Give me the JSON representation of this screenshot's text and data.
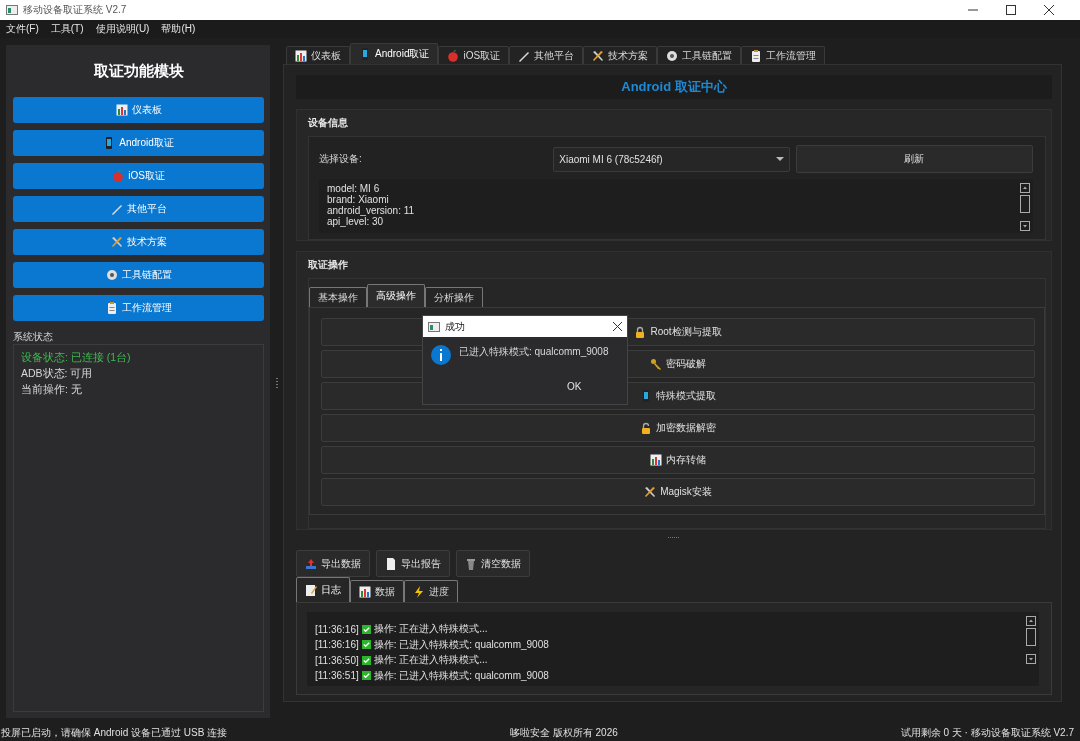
{
  "window": {
    "title": "移动设备取证系统 V2.7"
  },
  "menu": [
    "文件(F)",
    "工具(T)",
    "使用说明(U)",
    "帮助(H)"
  ],
  "sidebar": {
    "title": "取证功能模块",
    "buttons": [
      "仪表板",
      "Android取证",
      "iOS取证",
      "其他平台",
      "技术方案",
      "工具链配置",
      "工作流管理"
    ],
    "status_title": "系统状态",
    "status": [
      {
        "text": "设备状态: 已连接 (1台)",
        "color": "#3fb950"
      },
      {
        "text": "ADB状态: 可用"
      },
      {
        "text": "当前操作: 无"
      }
    ]
  },
  "tabs": [
    {
      "label": "仪表板",
      "selected": false
    },
    {
      "label": "Android取证",
      "selected": true
    },
    {
      "label": "iOS取证",
      "selected": false
    },
    {
      "label": "其他平台",
      "selected": false
    },
    {
      "label": "技术方案",
      "selected": false
    },
    {
      "label": "工具链配置",
      "selected": false
    },
    {
      "label": "工作流管理",
      "selected": false
    }
  ],
  "header": "Android 取证中心",
  "device_info": {
    "title": "设备信息",
    "select_label": "选择设备:",
    "device": "Xiaomi MI 6 (78c5246f)",
    "refresh": "刷新",
    "lines": [
      "model: MI 6",
      "brand: Xiaomi",
      "android_version: 11",
      "api_level: 30"
    ]
  },
  "operations": {
    "title": "取证操作",
    "tabs": [
      {
        "label": "基本操作",
        "selected": false
      },
      {
        "label": "高级操作",
        "selected": true
      },
      {
        "label": "分析操作",
        "selected": false
      }
    ],
    "buttons": [
      "Root检测与提取",
      "密码破解",
      "特殊模式提取",
      "加密数据解密",
      "内存转储",
      "Magisk安装"
    ]
  },
  "actions": [
    "导出数据",
    "导出报告",
    "清空数据"
  ],
  "output_tabs": [
    {
      "label": "日志",
      "selected": true
    },
    {
      "label": "数据",
      "selected": false
    },
    {
      "label": "进度",
      "selected": false
    }
  ],
  "log": [
    {
      "time": "[11:36:16]",
      "text": "操作: 正在进入特殊模式..."
    },
    {
      "time": "[11:36:16]",
      "text": "操作: 已进入特殊模式: qualcomm_9008"
    },
    {
      "time": "[11:36:50]",
      "text": "操作: 正在进入特殊模式..."
    },
    {
      "time": "[11:36:51]",
      "text": "操作: 已进入特殊模式: qualcomm_9008"
    }
  ],
  "dialog": {
    "title": "成功",
    "message": "已进入特殊模式: qualcomm_9008",
    "button": "OK"
  },
  "status_bar": {
    "left": "投屏已启动，请确保 Android 设备已通过 USB 连接",
    "center": "哆啦安全 版权所有 2026",
    "right": "试用剩余 0 天 · 移动设备取证系统 V2.7"
  }
}
